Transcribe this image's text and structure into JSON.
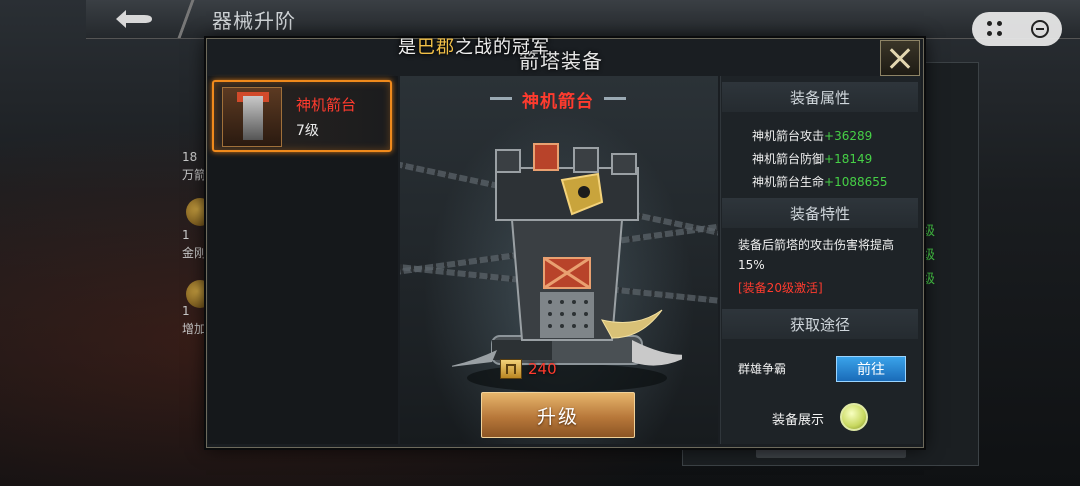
{
  "page": {
    "title": "器械升阶"
  },
  "left_column": {
    "items": [
      "18",
      "万箭",
      "1",
      "金刚",
      "1",
      "增加"
    ]
  },
  "right_column": {
    "levels": [
      "级",
      "级",
      "级"
    ]
  },
  "dialog": {
    "banner_prefix": "是",
    "banner_highlight": "巴郡",
    "banner_suffix": "之战的冠军",
    "title": "箭塔装备"
  },
  "equipment_list": [
    {
      "name": "神机箭台",
      "level": "7级"
    }
  ],
  "selected_equipment": {
    "name": "神机箭台",
    "cost": "240",
    "upgrade_label": "升级"
  },
  "info": {
    "attributes_header": "装备属性",
    "stats": [
      {
        "label": "神机箭台攻击",
        "bonus": "+36289"
      },
      {
        "label": "神机箭台防御",
        "bonus": "+18149"
      },
      {
        "label": "神机箭台生命",
        "bonus": "+1088655"
      }
    ],
    "traits_header": "装备特性",
    "trait_description": "装备后箭塔的攻击伤害将提高15%",
    "trait_activation": "[装备20级激活]",
    "source_header": "获取途径",
    "source_name": "群雄争霸",
    "goto_label": "前往",
    "showcase_label": "装备展示"
  },
  "colors": {
    "highlight_red": "#ff3b2e",
    "bonus_green": "#46d046",
    "gold": "#f2c048",
    "selection_orange": "#f08a1c"
  }
}
